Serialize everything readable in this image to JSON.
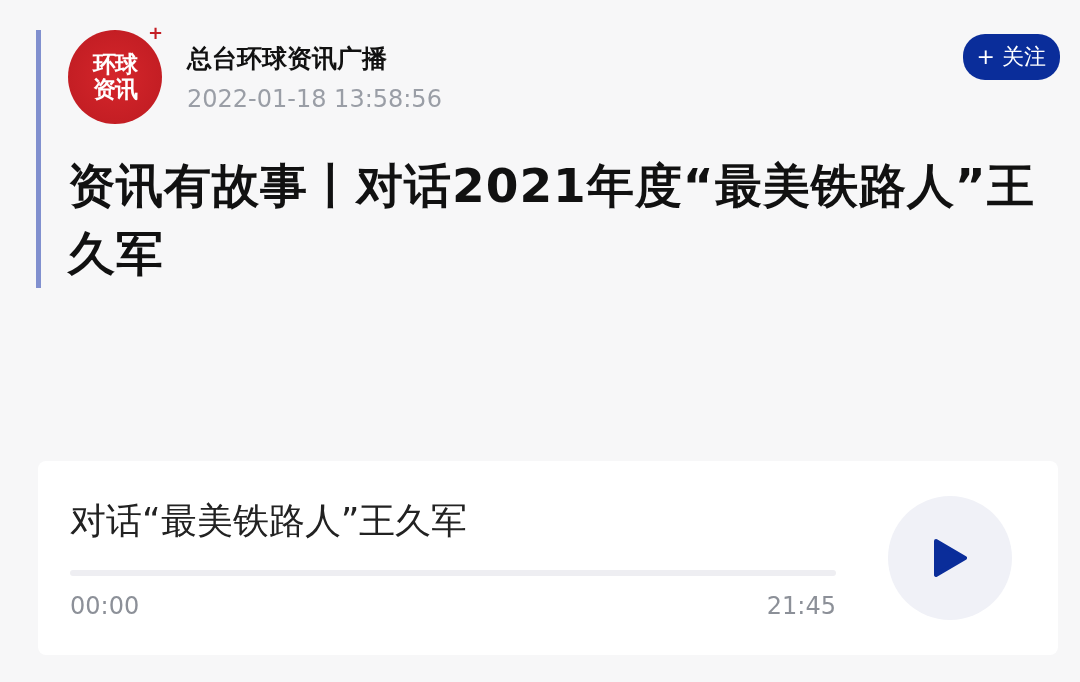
{
  "header": {
    "logo": {
      "lines": [
        "环球",
        "资讯"
      ],
      "badge": "+"
    },
    "author": "总台环球资讯广播",
    "date": "2022-01-18 13:58:56",
    "follow_button": "+ 关注"
  },
  "title": "资讯有故事丨对话2021年度“最美铁路人”王久军",
  "audio_player": {
    "title": "对话“最美铁路人”王久军",
    "level": 0,
    "current_time": "00:00",
    "duration": "21:45",
    "playing": false
  }
}
